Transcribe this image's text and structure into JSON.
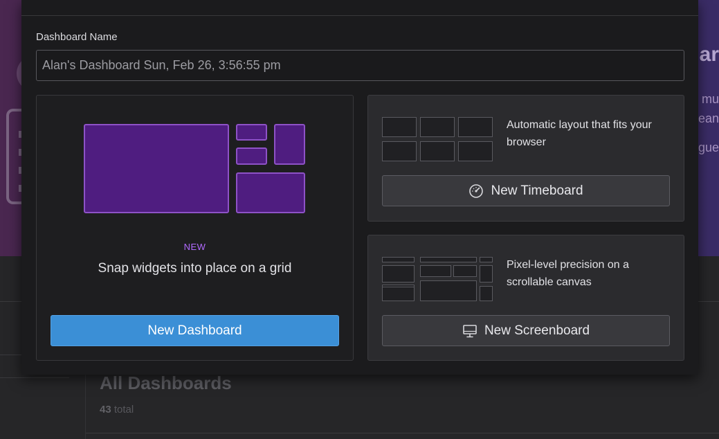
{
  "background": {
    "hero_right_lines": [
      "ar",
      "mu",
      "ean",
      "gue"
    ],
    "section_title": "All Dashboards",
    "count_number": "43",
    "count_suffix": "total"
  },
  "modal": {
    "name_label": "Dashboard Name",
    "name_value": "Alan's Dashboard Sun, Feb 26, 3:56:55 pm",
    "dashboard_option": {
      "badge": "NEW",
      "description": "Snap widgets into place on a grid",
      "button_label": "New Dashboard"
    },
    "timeboard_option": {
      "description": "Automatic layout that fits your browser",
      "button_label": "New Timeboard",
      "icon": "speedometer-icon"
    },
    "screenboard_option": {
      "description": "Pixel-level precision on a scrollable canvas",
      "button_label": "New Screenboard",
      "icon": "monitor-icon"
    }
  },
  "colors": {
    "primary_button": "#3b8fd6",
    "grid_block_fill": "#4f1d80",
    "grid_block_border": "#8e52c7",
    "new_badge": "#b26bff"
  }
}
